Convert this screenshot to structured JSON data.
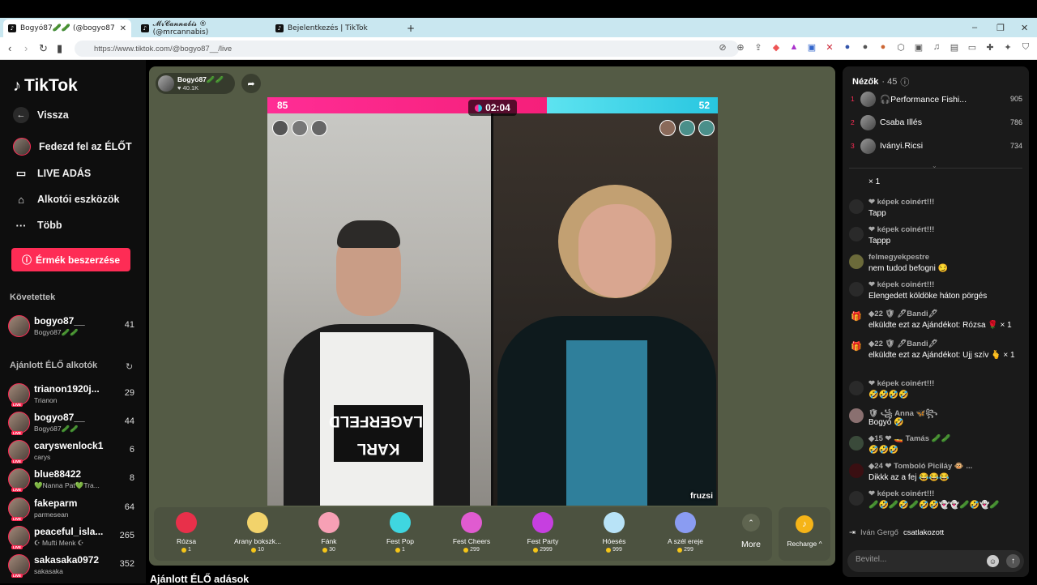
{
  "browser": {
    "tabs": [
      {
        "title": "Bogyó87🥒🥒 (@bogyo87"
      },
      {
        "title": "𝓜𝓻𝓒𝓪𝓷𝓷𝓪𝓫𝓲𝓼 ® (@mrcannabis)"
      },
      {
        "title": "Bejelentkezés | TikTok"
      }
    ],
    "new_tab": "+",
    "url": "https://www.tiktok.com/@bogyo87__/live",
    "window_controls": [
      "–",
      "❐",
      "✕"
    ]
  },
  "sidebar": {
    "logo": "TikTok",
    "nav": [
      {
        "label": "Vissza",
        "icon": "arrow-left-icon"
      },
      {
        "label": "Fedezd fel az ÉLŐT",
        "icon": "avatar"
      },
      {
        "label": "LIVE ADÁS",
        "icon": "video-camera-icon"
      },
      {
        "label": "Alkotói eszközök",
        "icon": "lightbulb-icon"
      },
      {
        "label": "Több",
        "icon": "more-dots-icon"
      }
    ],
    "coins_button": "Érmék beszerzése",
    "following_title": "Követettek",
    "following": [
      {
        "name": "bogyo87__",
        "sub": "Bogyó87🥒🥒",
        "count": "41"
      }
    ],
    "recommended_title": "Ajánlott ÉLŐ alkotók",
    "recommended": [
      {
        "name": "trianon1920j...",
        "sub": "Trianon",
        "count": "29"
      },
      {
        "name": "bogyo87__",
        "sub": "Bogyó87🥒🥒",
        "count": "44"
      },
      {
        "name": "caryswenlock1",
        "sub": "carys",
        "count": "6"
      },
      {
        "name": "blue88422",
        "sub": "💚Nanna Pat💚Tra...",
        "count": "8"
      },
      {
        "name": "fakeparm",
        "sub": "parmesean",
        "count": "64"
      },
      {
        "name": "peaceful_isla...",
        "sub": "☪ Mufti Menk ☪",
        "count": "265"
      },
      {
        "name": "sakasaka0972",
        "sub": "sakasaka",
        "count": "352"
      }
    ],
    "live_badge": "LIVE"
  },
  "stage": {
    "host_name": "Bogyó87🥒🥒",
    "host_likes": "♥ 40.1K",
    "battle": {
      "left_score": "85",
      "right_score": "52",
      "left_share": 0.62,
      "timer": "02:04",
      "right_name": "fruzsi"
    },
    "gifts": [
      {
        "name": "Rózsa",
        "price": "1",
        "color": "#e8304a"
      },
      {
        "name": "Arany bokszk...",
        "price": "10",
        "color": "#f2d36b"
      },
      {
        "name": "Fánk",
        "price": "30",
        "color": "#f7a0b5"
      },
      {
        "name": "Fest Pop",
        "price": "1",
        "color": "#3fd6e0"
      },
      {
        "name": "Fest Cheers",
        "price": "299",
        "color": "#e05bd0"
      },
      {
        "name": "Fest Party",
        "price": "2999",
        "color": "#c63fe0"
      },
      {
        "name": "Hóesés",
        "price": "999",
        "color": "#b8e3f7"
      },
      {
        "name": "A szél ereje",
        "price": "299",
        "color": "#8a9cf2"
      }
    ],
    "more_label": "More",
    "recharge_label": "Recharge ^"
  },
  "bottom_title": "Ajánlott ÉLŐ adások",
  "chat": {
    "viewers_title": "Nézők",
    "viewers_count": "· 45",
    "top_viewers": [
      {
        "rank": "1",
        "name": "🎧Performance Fishi...",
        "coins": "905"
      },
      {
        "rank": "2",
        "name": "Csaba Illés",
        "coins": "786"
      },
      {
        "rank": "3",
        "name": "Iványi.Ricsi",
        "coins": "734"
      }
    ],
    "messages": [
      {
        "head": "",
        "text": "× 1"
      },
      {
        "head": "❤ képek coinért!!!",
        "text": "Tapp"
      },
      {
        "head": "❤ képek coinért!!!",
        "text": "Tappp"
      },
      {
        "head": "felmegyekpestre",
        "text": "nem tudod befogni 😏"
      },
      {
        "head": "❤ képek coinért!!!",
        "text": "Elengedett köldöke háton pörgés"
      },
      {
        "head": "◆22 🛡 🖊Bandi🖊",
        "text": "elküldte ezt az Ajándékot: Rózsa 🌹 × 1"
      },
      {
        "head": "◆22 🛡 🖊Bandi🖊",
        "text": "elküldte ezt az Ajándékot: Ujj szív 🫰 × 1"
      },
      {
        "head": "❤ képek coinért!!!",
        "text": "🤣🤣🤣🤣"
      },
      {
        "head": "🛡 ꧁ Anna 🦋꧂",
        "text": "Bogyó 🤣"
      },
      {
        "head": "◆15 ❤ 🚤 Tamás 🥒🥒",
        "text": "🤣🤣🤣"
      },
      {
        "head": "◆24 ❤ Tomboló Piciláy 🐵 ...",
        "text": "Dikkk az a fej 😂😂😂"
      },
      {
        "head": "❤ képek coinért!!!",
        "text": "🥒🤣🥒🤣🥒🤣🤣👻👻🥒🤣👻🥒"
      }
    ],
    "joined_name": "Iván Gergő",
    "joined_text": "csatlakozott",
    "input_placeholder": "Bevitel..."
  }
}
